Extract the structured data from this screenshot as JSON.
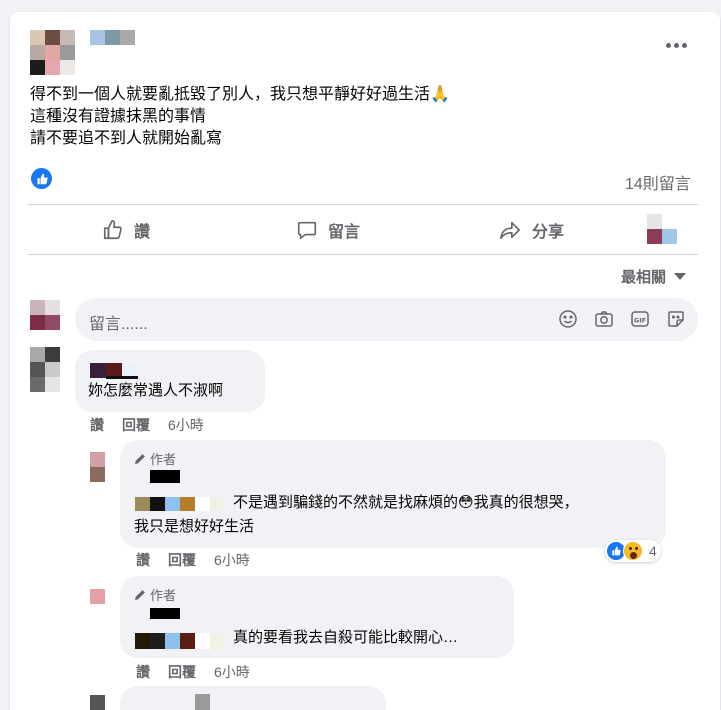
{
  "post": {
    "lines": [
      "得不到一個人就要亂抵毀了別人，我只想平靜好好過生活🙏",
      "這種沒有證據抹黑的事情",
      "請不要追不到人就開始亂寫"
    ],
    "comment_count": "14則留言"
  },
  "actions": {
    "like": "讚",
    "comment": "留言",
    "share": "分享"
  },
  "sort_label": "最相關",
  "comment_input": {
    "placeholder": "留言......"
  },
  "comments": [
    {
      "text": "妳怎麼常遇人不淑啊",
      "like": "讚",
      "reply": "回覆",
      "time": "6小時"
    },
    {
      "author_badge": "作者",
      "text_line1": "不是遇到騙錢的不然就是找麻煩的😳我真的很想哭，",
      "text_line2": "我只是想好好生活",
      "like": "讚",
      "reply": "回覆",
      "time": "6小時",
      "reaction_count": "4"
    },
    {
      "author_badge": "作者",
      "text": "真的要看我去自殺可能比較開心…",
      "like": "讚",
      "reply": "回覆",
      "time": "6小時"
    }
  ],
  "colors": {
    "accent": "#1877f2",
    "secondary_text": "#65676b",
    "bubble": "#f0f2f5"
  }
}
